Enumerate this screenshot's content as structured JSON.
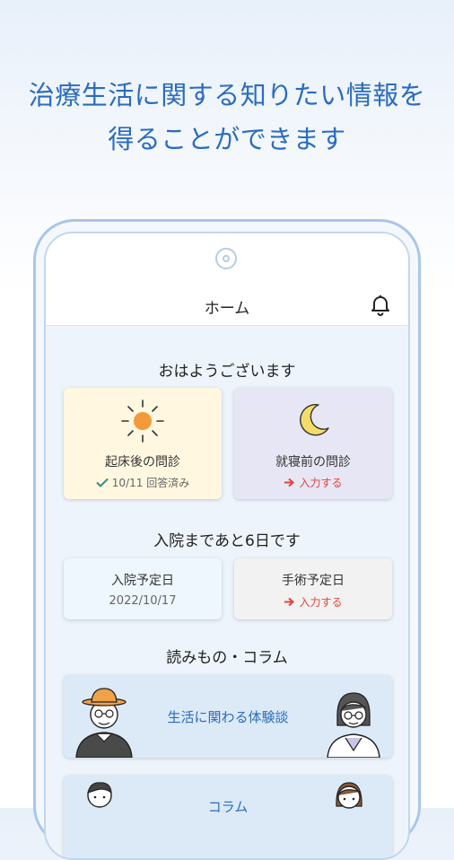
{
  "promo": {
    "line1": "治療生活に関する知りたい情報を",
    "line2": "得ることができます"
  },
  "navbar": {
    "title": "ホーム",
    "notification_icon": "bell-icon"
  },
  "greeting": "おはようございます",
  "questionnaires": [
    {
      "label": "起床後の問診",
      "status": "10/11 回答済み",
      "icon": "sun-icon"
    },
    {
      "label": "就寝前の問診",
      "status": "入力する",
      "icon": "moon-icon"
    }
  ],
  "countdown": "入院まであと6日です",
  "schedule": [
    {
      "label": "入院予定日",
      "value": "2022/10/17"
    },
    {
      "label": "手術予定日",
      "value": "入力する"
    }
  ],
  "reading": {
    "title": "読みもの・コラム",
    "banners": [
      {
        "label": "生活に関わる体験談"
      },
      {
        "label": "コラム"
      }
    ]
  },
  "colors": {
    "accent": "#2a6cbf",
    "done": "#3a8a7a",
    "todo": "#e2453c",
    "morning_bg": "#fff7e0",
    "night_bg": "#e6e6f5"
  }
}
